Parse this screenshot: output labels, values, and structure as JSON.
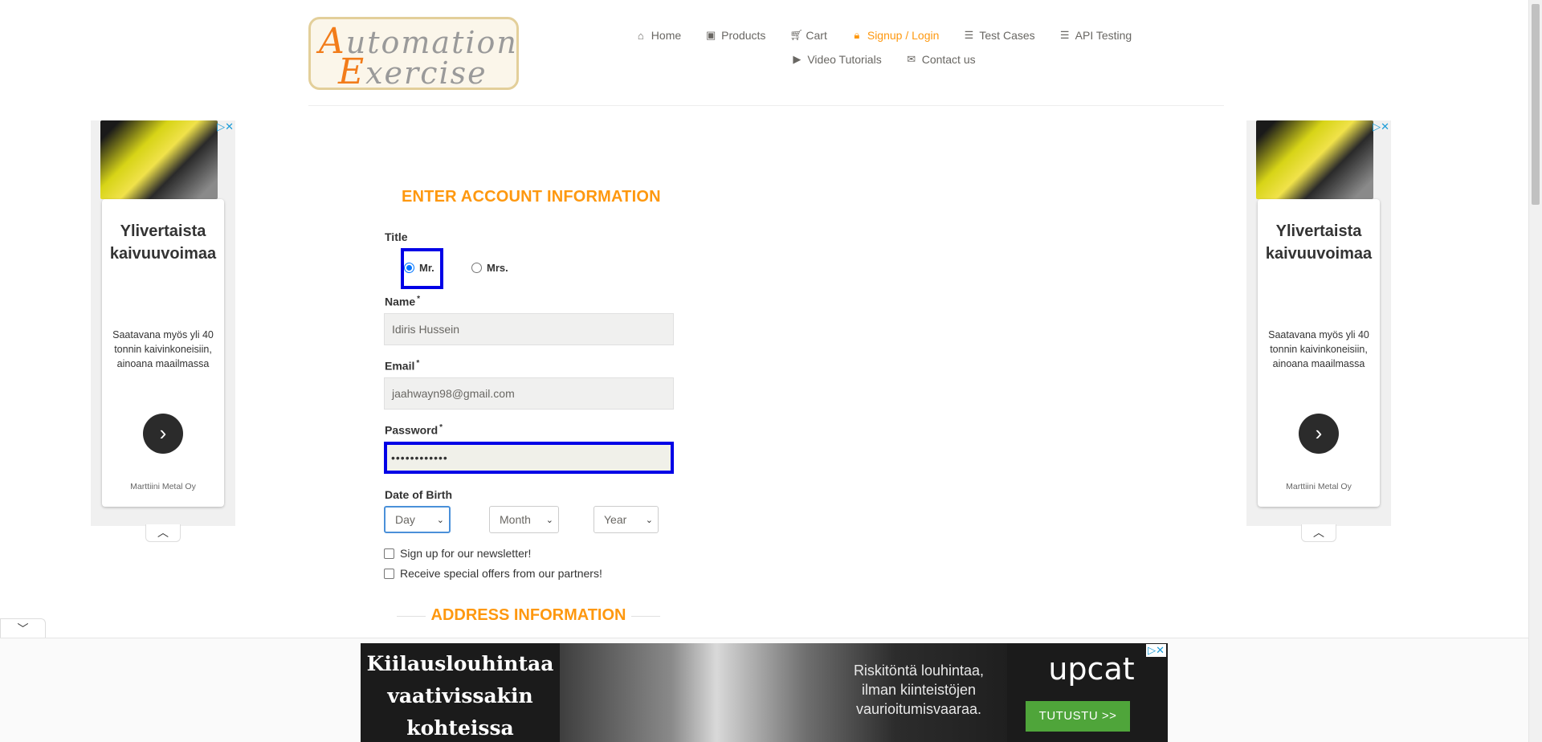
{
  "header": {
    "logo_line1": "Automation",
    "logo_line2": "Exercise",
    "nav": [
      {
        "label": "Home",
        "icon": "home-icon"
      },
      {
        "label": "Products",
        "icon": "products-icon"
      },
      {
        "label": "Cart",
        "icon": "cart-icon"
      },
      {
        "label": "Signup / Login",
        "icon": "lock-icon"
      },
      {
        "label": "Test Cases",
        "icon": "list-icon"
      },
      {
        "label": "API Testing",
        "icon": "list-icon"
      },
      {
        "label": "Video Tutorials",
        "icon": "youtube-icon"
      },
      {
        "label": "Contact us",
        "icon": "envelope-icon"
      }
    ],
    "active_color": "#fe980f"
  },
  "form": {
    "title": "ENTER ACCOUNT INFORMATION",
    "title_label": "Title",
    "title_options": [
      "Mr.",
      "Mrs."
    ],
    "title_selected": "Mr.",
    "name_label": "Name",
    "name_value": "Idiris Hussein",
    "email_label": "Email",
    "email_value": "jaahwayn98@gmail.com",
    "password_label": "Password",
    "password_value": "••••••••••••",
    "dob_label": "Date of Birth",
    "dob_day": "Day",
    "dob_month": "Month",
    "dob_year": "Year",
    "newsletter_label": "Sign up for our newsletter!",
    "offers_label": "Receive special offers from our partners!",
    "address_title": "ADDRESS INFORMATION",
    "required_mark": "*"
  },
  "side_ad": {
    "headline_line1": "Ylivertaista",
    "headline_line2": "kaivuuvoimaa",
    "body_line1": "Saatavana myös yli 40",
    "body_line2": "tonnin kaivinkoneisiin,",
    "body_line3": "ainoana maailmassa",
    "sponsor": "Marttiini Metal Oy"
  },
  "bottom_ad": {
    "line1": "Kiilauslouhintaa",
    "line2": "vaativissakin",
    "line3": "kohteissa",
    "side_line1": "Riskitöntä louhintaa,",
    "side_line2": "ilman kiinteistöjen",
    "side_line3": "vaurioitumisvaaraa.",
    "brand": "upcat",
    "button": "TUTUSTU >>"
  }
}
